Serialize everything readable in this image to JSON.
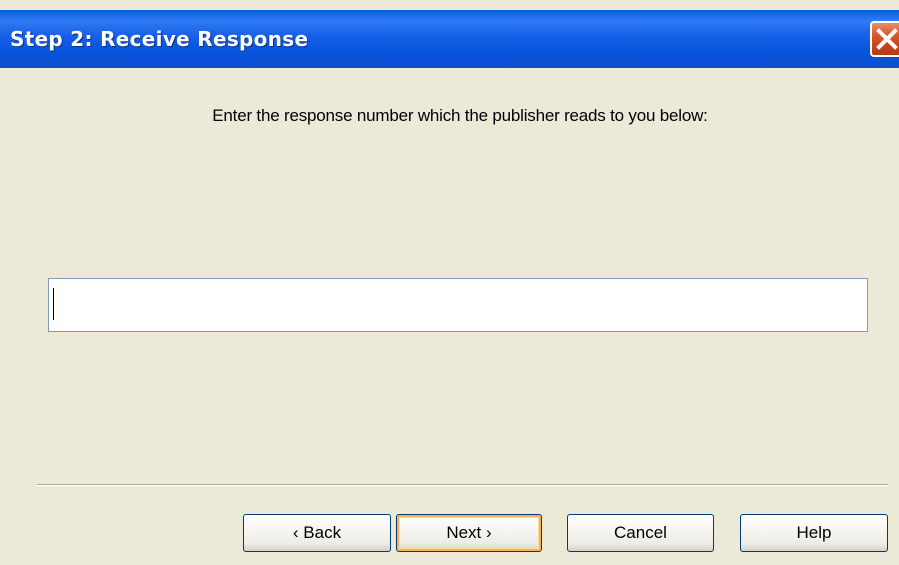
{
  "window": {
    "title": "Step 2: Receive Response",
    "close_icon": "close-x-icon"
  },
  "main": {
    "instruction": "Enter the response number which the publisher reads to you below:",
    "response_input": {
      "value": "",
      "placeholder": ""
    }
  },
  "footer": {
    "back_label": "‹ Back",
    "next_label": "Next ›",
    "cancel_label": "Cancel",
    "help_label": "Help"
  },
  "colors": {
    "titlebar": "#0A5BE0",
    "background": "#ECE9D8",
    "close_button": "#D85A2E",
    "default_button_highlight": "#F8B351"
  }
}
